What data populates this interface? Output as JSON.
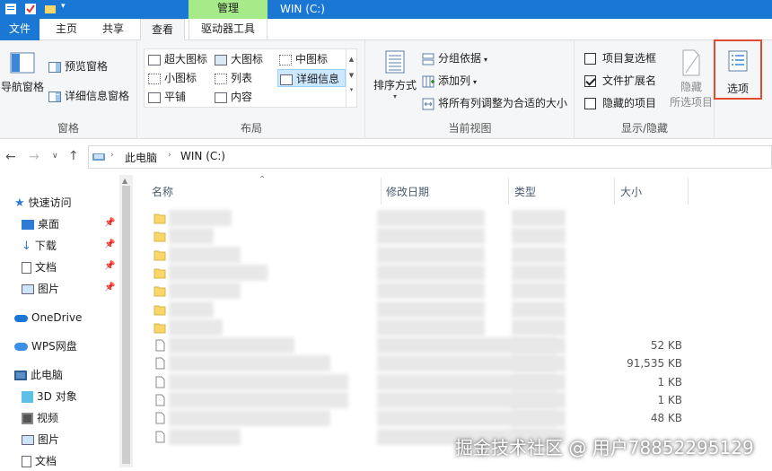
{
  "titlebar": {
    "manage_tab": "管理",
    "window_title": "WIN (C:)"
  },
  "tabs": [
    {
      "label": "文件"
    },
    {
      "label": "主页"
    },
    {
      "label": "共享"
    },
    {
      "label": "查看"
    },
    {
      "label": "驱动器工具"
    }
  ],
  "ribbon": {
    "panes_group": {
      "nav_pane": "导航窗格",
      "preview_pane": "预览窗格",
      "details_pane": "详细信息窗格",
      "label": "窗格"
    },
    "layout_group": {
      "items": [
        "超大图标",
        "大图标",
        "中图标",
        "小图标",
        "列表",
        "详细信息",
        "平铺",
        "内容"
      ],
      "label": "布局"
    },
    "view_group": {
      "sort_by": "排序方式",
      "group_by": "分组依据",
      "add_columns": "添加列",
      "fit_columns": "将所有列调整为合适的大小",
      "label": "当前视图"
    },
    "showhide_group": {
      "item_checkboxes": "项目复选框",
      "file_extensions": "文件扩展名",
      "hidden_items": "隐藏的项目",
      "hide_selected_1": "隐藏",
      "hide_selected_2": "所选项目",
      "label": "显示/隐藏",
      "item_checkboxes_checked": false,
      "file_extensions_checked": true,
      "hidden_items_checked": false
    },
    "options": {
      "label": "选项"
    }
  },
  "address": {
    "path_root": "此电脑",
    "path_current": "WIN (C:)"
  },
  "nav_pane": {
    "items": [
      {
        "label": "快速访问"
      },
      {
        "label": "桌面"
      },
      {
        "label": "下载"
      },
      {
        "label": "文档"
      },
      {
        "label": "图片"
      },
      {
        "label": "OneDrive"
      },
      {
        "label": "WPS网盘"
      },
      {
        "label": "此电脑"
      },
      {
        "label": "3D 对象"
      },
      {
        "label": "视频"
      },
      {
        "label": "图片"
      },
      {
        "label": "文档"
      }
    ]
  },
  "file_list": {
    "columns": [
      "名称",
      "修改日期",
      "类型",
      "大小"
    ],
    "rows": [
      {
        "size": ""
      },
      {
        "size": ""
      },
      {
        "size": ""
      },
      {
        "size": ""
      },
      {
        "size": ""
      },
      {
        "size": ""
      },
      {
        "size": ""
      },
      {
        "size": "52 KB"
      },
      {
        "size": "91,535 KB"
      },
      {
        "size": "1 KB"
      },
      {
        "size": "1 KB"
      },
      {
        "size": "48 KB"
      },
      {
        "size": ""
      }
    ]
  },
  "watermark": "掘金技术社区 @ 用户78852295129",
  "colors": {
    "accent": "#1a78d4",
    "manage": "#a6ea89",
    "highlight": "#e14b2e",
    "folder": "#f8d66a"
  }
}
